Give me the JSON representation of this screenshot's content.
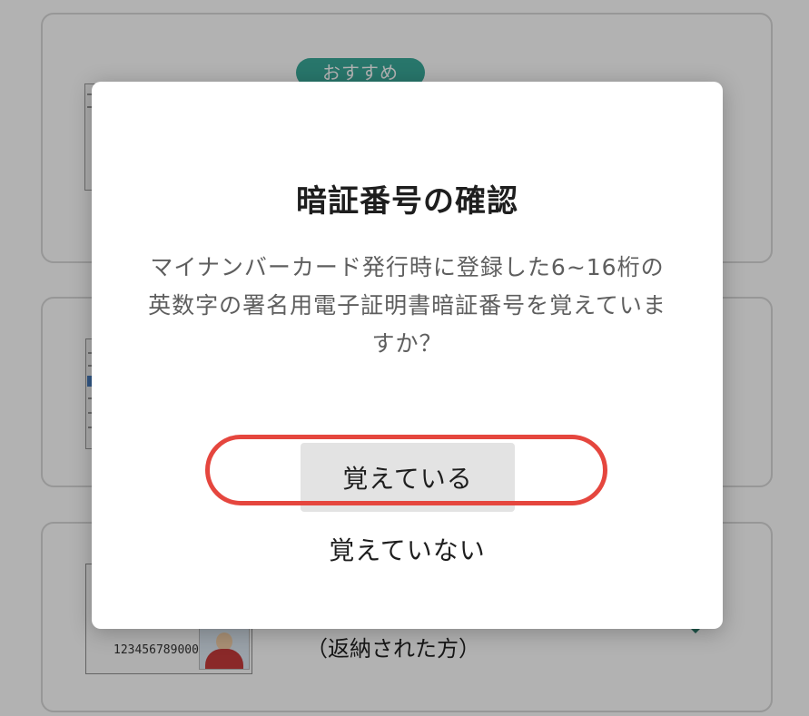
{
  "background": {
    "card_1": {
      "badge": "おすすめ"
    },
    "card_3": {
      "license_number": "123456789000",
      "label": "（返納された方）"
    }
  },
  "dialog": {
    "title": "暗証番号の確認",
    "message": "マイナンバーカード発行時に登録した6~16桁の英数字の署名用電子証明書暗証番号を覚えていますか？",
    "primary_button": "覚えている",
    "secondary_button": "覚えていない"
  },
  "colors": {
    "highlight_ring": "#e5463e",
    "badge": "#3aa99a",
    "overlay": "rgba(0,0,0,0.30)"
  }
}
